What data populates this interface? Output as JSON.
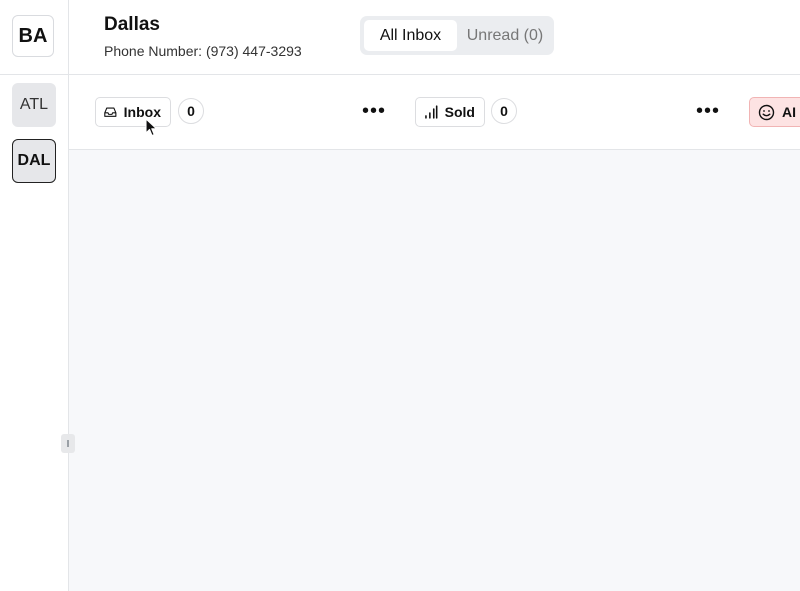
{
  "org": {
    "initials": "BA"
  },
  "locations": [
    {
      "label": "ATL",
      "selected": false
    },
    {
      "label": "DAL",
      "selected": true
    }
  ],
  "header": {
    "title": "Dallas",
    "phone": "Phone Number: (973) 447-3293"
  },
  "filters": {
    "all_label": "All Inbox",
    "unread_label": "Unread (0)"
  },
  "columns": [
    {
      "label": "Inbox",
      "icon": "inbox-tray-icon",
      "count": "0"
    },
    {
      "label": "Sold",
      "icon": "signal-bars-icon",
      "count": "0"
    },
    {
      "label": "AI C",
      "icon": "smiley-icon",
      "accent": "#fde3e3"
    }
  ],
  "colors": {
    "accent_chip_bg": "#fde3e3",
    "accent_chip_border": "#f1b4b4",
    "background": "#f7f8fa"
  }
}
